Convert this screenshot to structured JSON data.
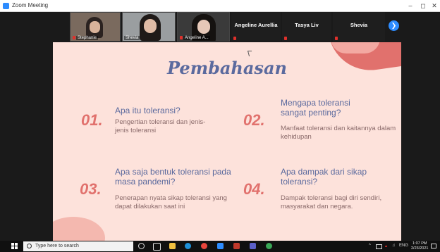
{
  "window": {
    "title": "Zoom Meeting",
    "controls": [
      "–",
      "◻",
      "✕"
    ]
  },
  "gallery": {
    "video_participants": [
      "Stephanie",
      "Shevia",
      "Angeline A..."
    ],
    "name_participants": [
      "Angeline Aurellia",
      "Tasya Liv",
      "Shevia"
    ],
    "next_icon": "chevron-right-icon"
  },
  "slide": {
    "title": "Pembahasan",
    "items": [
      {
        "number": "01.",
        "title": "Apa itu toleransi?",
        "desc": "Pengertian toleransi dan jenis-jenis toleransi"
      },
      {
        "number": "02.",
        "title": "Mengapa toleransi sangat penting?",
        "desc": "Manfaat toleransi dan kaitannya dalam kehidupan"
      },
      {
        "number": "03.",
        "title": "Apa saja bentuk toleransi pada masa pandemi?",
        "desc": "Penerapan nyata sikap toleransi yang dapat dilakukan saat ini"
      },
      {
        "number": "04.",
        "title": "Apa dampak dari sikap toleransi?",
        "desc": "Dampak toleransi bagi diri sendiri, masyarakat dan negara."
      }
    ],
    "colors": {
      "background": "#fde2db",
      "accent": "#e1716d",
      "heading": "#5b6a9e"
    }
  },
  "taskbar": {
    "search_placeholder": "Type here to search",
    "tray_text": "ENG",
    "time": "1:07 PM",
    "date": "2/23/2021"
  }
}
